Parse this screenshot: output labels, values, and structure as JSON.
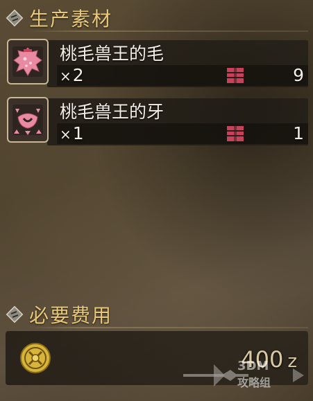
{
  "materials_section": {
    "title": "生产素材",
    "icon": "diamond-hash-icon"
  },
  "materials": [
    {
      "name": "桃毛兽王的毛",
      "quantity_prefix": "×",
      "quantity": "2",
      "owned": "9",
      "icon": "pink-fur-icon",
      "owned_icon": "item-box-icon"
    },
    {
      "name": "桃毛兽王的牙",
      "quantity_prefix": "×",
      "quantity": "1",
      "owned": "1",
      "icon": "pink-fang-icon",
      "owned_icon": "item-box-icon"
    }
  ],
  "cost_section": {
    "title": "必要费用",
    "icon": "diamond-hash-icon"
  },
  "cost": {
    "amount": "400",
    "unit": "z",
    "icon": "zenny-coin-icon"
  },
  "watermark": {
    "text": "3DM",
    "subtext": "攻略组"
  },
  "colors": {
    "title": "#e9c877",
    "icon_pink": "#e88aa0",
    "icon_border": "#c9b896",
    "box_icon": "#c7415a"
  }
}
